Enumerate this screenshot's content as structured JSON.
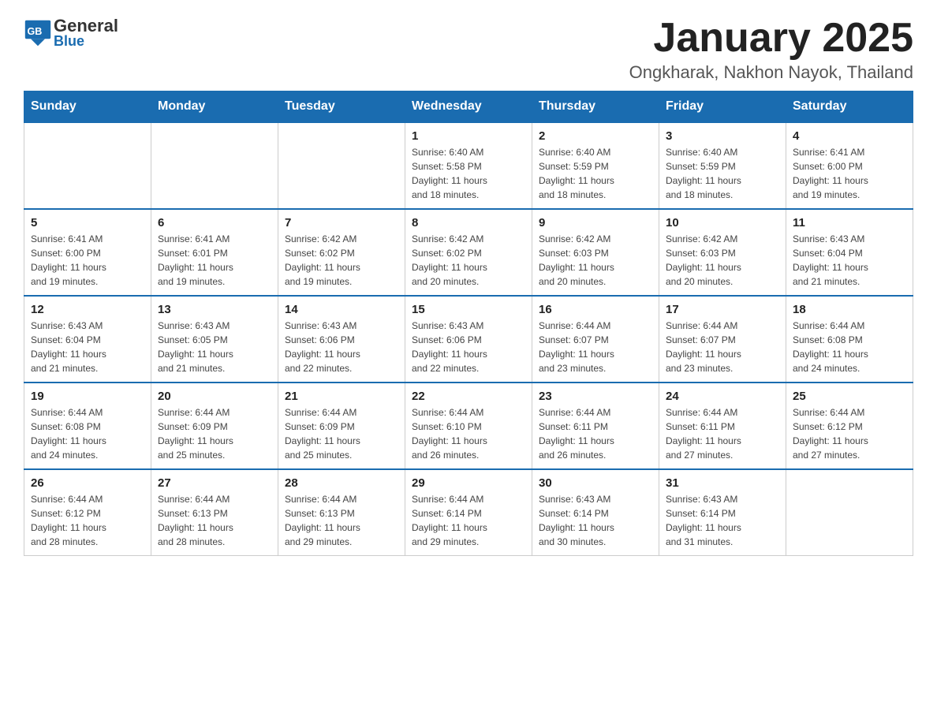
{
  "header": {
    "logo_general": "General",
    "logo_blue": "Blue",
    "month_title": "January 2025",
    "location": "Ongkharak, Nakhon Nayok, Thailand"
  },
  "weekdays": [
    "Sunday",
    "Monday",
    "Tuesday",
    "Wednesday",
    "Thursday",
    "Friday",
    "Saturday"
  ],
  "weeks": [
    [
      {
        "day": "",
        "info": ""
      },
      {
        "day": "",
        "info": ""
      },
      {
        "day": "",
        "info": ""
      },
      {
        "day": "1",
        "info": "Sunrise: 6:40 AM\nSunset: 5:58 PM\nDaylight: 11 hours\nand 18 minutes."
      },
      {
        "day": "2",
        "info": "Sunrise: 6:40 AM\nSunset: 5:59 PM\nDaylight: 11 hours\nand 18 minutes."
      },
      {
        "day": "3",
        "info": "Sunrise: 6:40 AM\nSunset: 5:59 PM\nDaylight: 11 hours\nand 18 minutes."
      },
      {
        "day": "4",
        "info": "Sunrise: 6:41 AM\nSunset: 6:00 PM\nDaylight: 11 hours\nand 19 minutes."
      }
    ],
    [
      {
        "day": "5",
        "info": "Sunrise: 6:41 AM\nSunset: 6:00 PM\nDaylight: 11 hours\nand 19 minutes."
      },
      {
        "day": "6",
        "info": "Sunrise: 6:41 AM\nSunset: 6:01 PM\nDaylight: 11 hours\nand 19 minutes."
      },
      {
        "day": "7",
        "info": "Sunrise: 6:42 AM\nSunset: 6:02 PM\nDaylight: 11 hours\nand 19 minutes."
      },
      {
        "day": "8",
        "info": "Sunrise: 6:42 AM\nSunset: 6:02 PM\nDaylight: 11 hours\nand 20 minutes."
      },
      {
        "day": "9",
        "info": "Sunrise: 6:42 AM\nSunset: 6:03 PM\nDaylight: 11 hours\nand 20 minutes."
      },
      {
        "day": "10",
        "info": "Sunrise: 6:42 AM\nSunset: 6:03 PM\nDaylight: 11 hours\nand 20 minutes."
      },
      {
        "day": "11",
        "info": "Sunrise: 6:43 AM\nSunset: 6:04 PM\nDaylight: 11 hours\nand 21 minutes."
      }
    ],
    [
      {
        "day": "12",
        "info": "Sunrise: 6:43 AM\nSunset: 6:04 PM\nDaylight: 11 hours\nand 21 minutes."
      },
      {
        "day": "13",
        "info": "Sunrise: 6:43 AM\nSunset: 6:05 PM\nDaylight: 11 hours\nand 21 minutes."
      },
      {
        "day": "14",
        "info": "Sunrise: 6:43 AM\nSunset: 6:06 PM\nDaylight: 11 hours\nand 22 minutes."
      },
      {
        "day": "15",
        "info": "Sunrise: 6:43 AM\nSunset: 6:06 PM\nDaylight: 11 hours\nand 22 minutes."
      },
      {
        "day": "16",
        "info": "Sunrise: 6:44 AM\nSunset: 6:07 PM\nDaylight: 11 hours\nand 23 minutes."
      },
      {
        "day": "17",
        "info": "Sunrise: 6:44 AM\nSunset: 6:07 PM\nDaylight: 11 hours\nand 23 minutes."
      },
      {
        "day": "18",
        "info": "Sunrise: 6:44 AM\nSunset: 6:08 PM\nDaylight: 11 hours\nand 24 minutes."
      }
    ],
    [
      {
        "day": "19",
        "info": "Sunrise: 6:44 AM\nSunset: 6:08 PM\nDaylight: 11 hours\nand 24 minutes."
      },
      {
        "day": "20",
        "info": "Sunrise: 6:44 AM\nSunset: 6:09 PM\nDaylight: 11 hours\nand 25 minutes."
      },
      {
        "day": "21",
        "info": "Sunrise: 6:44 AM\nSunset: 6:09 PM\nDaylight: 11 hours\nand 25 minutes."
      },
      {
        "day": "22",
        "info": "Sunrise: 6:44 AM\nSunset: 6:10 PM\nDaylight: 11 hours\nand 26 minutes."
      },
      {
        "day": "23",
        "info": "Sunrise: 6:44 AM\nSunset: 6:11 PM\nDaylight: 11 hours\nand 26 minutes."
      },
      {
        "day": "24",
        "info": "Sunrise: 6:44 AM\nSunset: 6:11 PM\nDaylight: 11 hours\nand 27 minutes."
      },
      {
        "day": "25",
        "info": "Sunrise: 6:44 AM\nSunset: 6:12 PM\nDaylight: 11 hours\nand 27 minutes."
      }
    ],
    [
      {
        "day": "26",
        "info": "Sunrise: 6:44 AM\nSunset: 6:12 PM\nDaylight: 11 hours\nand 28 minutes."
      },
      {
        "day": "27",
        "info": "Sunrise: 6:44 AM\nSunset: 6:13 PM\nDaylight: 11 hours\nand 28 minutes."
      },
      {
        "day": "28",
        "info": "Sunrise: 6:44 AM\nSunset: 6:13 PM\nDaylight: 11 hours\nand 29 minutes."
      },
      {
        "day": "29",
        "info": "Sunrise: 6:44 AM\nSunset: 6:14 PM\nDaylight: 11 hours\nand 29 minutes."
      },
      {
        "day": "30",
        "info": "Sunrise: 6:43 AM\nSunset: 6:14 PM\nDaylight: 11 hours\nand 30 minutes."
      },
      {
        "day": "31",
        "info": "Sunrise: 6:43 AM\nSunset: 6:14 PM\nDaylight: 11 hours\nand 31 minutes."
      },
      {
        "day": "",
        "info": ""
      }
    ]
  ]
}
